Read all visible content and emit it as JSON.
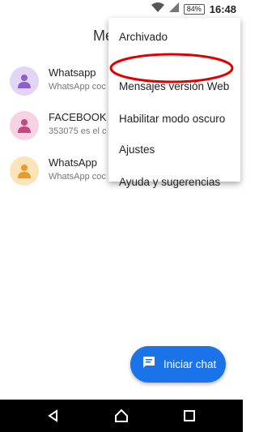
{
  "status": {
    "time": "16:48",
    "battery": "84%"
  },
  "appbar": {
    "title": "Me"
  },
  "conversations": [
    {
      "name": "Whatsapp",
      "snippet": "WhatsApp coc",
      "avatar_bg": "#e3d5f5",
      "avatar_fg": "#8e5fc8"
    },
    {
      "name": "FACEBOOK",
      "snippet": "353075 es el c",
      "avatar_bg": "#f7d2e4",
      "avatar_fg": "#c4477f"
    },
    {
      "name": "WhatsApp",
      "snippet": "WhatsApp coc",
      "avatar_bg": "#fce3b8",
      "avatar_fg": "#e89a2b"
    }
  ],
  "menu": {
    "items": [
      "Archivado",
      "Mensajes versión Web",
      "Habilitar modo oscuro",
      "Ajustes",
      "Ayuda y sugerencias"
    ]
  },
  "fab": {
    "label": "Iniciar chat",
    "color": "#1a73e8"
  },
  "annotation_color": "#e00000"
}
